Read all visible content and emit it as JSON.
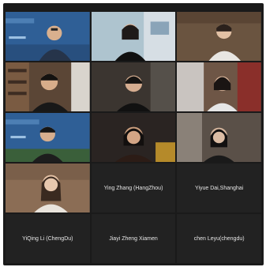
{
  "participants": [
    {
      "video": true,
      "active": false,
      "scene": "blue-presentation"
    },
    {
      "video": true,
      "active": true,
      "scene": "bright-room"
    },
    {
      "video": true,
      "active": false,
      "scene": "warm-room"
    },
    {
      "video": true,
      "active": false,
      "scene": "bookshelf"
    },
    {
      "video": true,
      "active": false,
      "scene": "dark-room"
    },
    {
      "video": true,
      "active": false,
      "scene": "bedroom"
    },
    {
      "video": true,
      "active": false,
      "scene": "blue-presentation"
    },
    {
      "video": true,
      "active": false,
      "scene": "dim-room"
    },
    {
      "video": true,
      "active": false,
      "scene": "light-room"
    },
    {
      "video": true,
      "active": false,
      "scene": "beige-room"
    },
    {
      "video": false,
      "name": "Ying Zhang (HangZhou)"
    },
    {
      "video": false,
      "name": "Yiyue Dai,Shanghai"
    },
    {
      "video": false,
      "name": "YiQing Li (ChengDu)"
    },
    {
      "video": false,
      "name": "Jiayi Zheng Xiamen"
    },
    {
      "video": false,
      "name": "chen Leyu(chengdu)"
    }
  ],
  "colors": {
    "active_border": "#8fbf3a",
    "tile_bg": "#222222"
  }
}
